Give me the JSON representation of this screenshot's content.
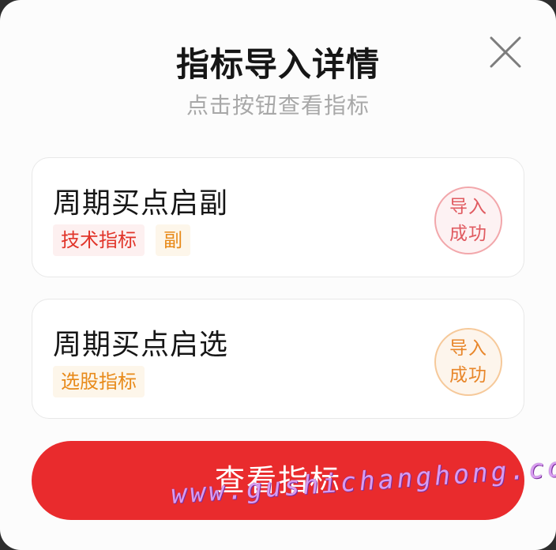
{
  "dialog": {
    "title": "指标导入详情",
    "subtitle": "点击按钮查看指标",
    "close_icon": "close-icon"
  },
  "items": [
    {
      "name": "周期买点启副",
      "tags": [
        {
          "label": "技术指标",
          "color": "#e1352a"
        },
        {
          "label": "副",
          "color": "#e88a1a"
        }
      ],
      "status_line1": "导入",
      "status_line2": "成功",
      "status_color": "#e05a60"
    },
    {
      "name": "周期买点启选",
      "tags": [
        {
          "label": "选股指标",
          "color": "#e88a1a"
        }
      ],
      "status_line1": "导入",
      "status_line2": "成功",
      "status_color": "#e8862a"
    }
  ],
  "primary_button": {
    "label": "查看指标",
    "color": "#e92b2d"
  },
  "watermark": "www.gushichanghong.com"
}
